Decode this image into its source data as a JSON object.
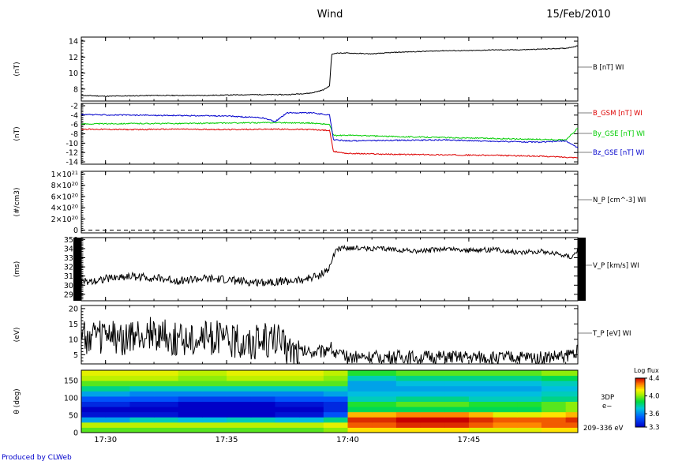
{
  "header": {
    "title": "Wind",
    "date": "15/Feb/2010",
    "footer": "Produced by CLWeb"
  },
  "colors": {
    "black": "#000000",
    "red": "#dd0000",
    "green": "#00cc00",
    "blue": "#0000cc",
    "footer_blue": "#0000cc"
  },
  "time_axis": {
    "start": "17:29:00",
    "end": "17:49:30",
    "tick_labels": [
      "17:30",
      "17:35",
      "17:40",
      "17:45"
    ]
  },
  "chart_data": [
    {
      "type": "line",
      "id": "b_total",
      "ylabel": "(nT)",
      "ylim": [
        6.5,
        14.5
      ],
      "yticks": [
        8,
        10,
        12,
        14
      ],
      "series": [
        {
          "name": "B [nT] WI",
          "color": "#000000",
          "x": [
            "17:29:00",
            "17:30:00",
            "17:32:00",
            "17:34:00",
            "17:36:00",
            "17:37:30",
            "17:38:30",
            "17:39:00",
            "17:39:15",
            "17:39:20",
            "17:39:30",
            "17:40:00",
            "17:41:00",
            "17:42:00",
            "17:43:00",
            "17:44:00",
            "17:45:00",
            "17:46:00",
            "17:47:00",
            "17:48:00",
            "17:49:00",
            "17:49:30"
          ],
          "values": [
            7.2,
            7.1,
            7.2,
            7.2,
            7.3,
            7.3,
            7.5,
            7.9,
            8.4,
            12.3,
            12.5,
            12.5,
            12.4,
            12.6,
            12.7,
            12.8,
            12.8,
            12.9,
            12.9,
            13.0,
            13.1,
            13.4
          ]
        }
      ]
    },
    {
      "type": "line",
      "id": "b_components",
      "ylabel": "(nT)",
      "ylim": [
        -14.5,
        -1.5
      ],
      "yticks": [
        -2,
        -4,
        -6,
        -8,
        -10,
        -12,
        -14
      ],
      "series": [
        {
          "name": "B_GSM [nT] WI",
          "color": "#dd0000",
          "x": [
            "17:29:00",
            "17:31:00",
            "17:33:00",
            "17:35:00",
            "17:37:00",
            "17:38:30",
            "17:39:15",
            "17:39:25",
            "17:40:00",
            "17:42:00",
            "17:44:00",
            "17:46:00",
            "17:48:00",
            "17:49:30"
          ],
          "values": [
            -7.0,
            -7.1,
            -7.0,
            -7.1,
            -7.0,
            -7.1,
            -7.3,
            -11.8,
            -12.2,
            -12.4,
            -12.5,
            -12.6,
            -12.8,
            -13.1
          ]
        },
        {
          "name": "By_GSE [nT] WI",
          "color": "#00cc00",
          "x": [
            "17:29:00",
            "17:31:00",
            "17:33:00",
            "17:35:00",
            "17:37:00",
            "17:38:30",
            "17:39:15",
            "17:39:25",
            "17:40:00",
            "17:42:00",
            "17:44:00",
            "17:46:00",
            "17:48:00",
            "17:49:00",
            "17:49:30"
          ],
          "values": [
            -5.9,
            -5.8,
            -5.8,
            -5.7,
            -5.6,
            -5.7,
            -6.0,
            -8.4,
            -8.3,
            -8.6,
            -8.8,
            -9.0,
            -9.2,
            -9.3,
            -6.8
          ]
        },
        {
          "name": "Bz_GSE [nT] WI",
          "color": "#0000cc",
          "x": [
            "17:29:00",
            "17:31:00",
            "17:33:00",
            "17:35:00",
            "17:36:30",
            "17:37:00",
            "17:37:30",
            "17:38:30",
            "17:39:15",
            "17:39:25",
            "17:40:00",
            "17:42:00",
            "17:44:00",
            "17:46:00",
            "17:48:00",
            "17:49:00",
            "17:49:30"
          ],
          "values": [
            -3.9,
            -4.0,
            -4.1,
            -4.2,
            -4.6,
            -5.4,
            -3.5,
            -3.5,
            -4.0,
            -9.3,
            -9.5,
            -9.4,
            -9.3,
            -9.6,
            -9.8,
            -9.5,
            -11.0
          ]
        }
      ]
    },
    {
      "type": "line",
      "id": "density",
      "ylabel": "(#/cm3)",
      "ylim": [
        -5e+19,
        1.05e+21
      ],
      "yticks": [
        0,
        2e+20,
        4e+20,
        6e+20,
        8e+20,
        1e+21
      ],
      "ytick_labels": [
        {
          "mant": "0",
          "exp": ""
        },
        {
          "mant": "2×10",
          "exp": "20"
        },
        {
          "mant": "4×10",
          "exp": "20"
        },
        {
          "mant": "6×10",
          "exp": "20"
        },
        {
          "mant": "8×10",
          "exp": "20"
        },
        {
          "mant": "1×10",
          "exp": "21"
        }
      ],
      "series": [
        {
          "name": "N_P [cm^-3] WI",
          "color": "#000000",
          "dashed": true,
          "x": [
            "17:29:00",
            "17:49:30"
          ],
          "values": [
            0,
            0
          ]
        }
      ]
    },
    {
      "type": "line",
      "id": "velocity",
      "ylabel": "(ms)",
      "ylim": [
        283,
        352
      ],
      "yticks": [
        290,
        300,
        310,
        320,
        330,
        340,
        350
      ],
      "series": [
        {
          "name": "V_P [km/s] WI",
          "color": "#000000",
          "x": [
            "17:29:00",
            "17:30:00",
            "17:31:00",
            "17:32:00",
            "17:33:00",
            "17:34:00",
            "17:35:00",
            "17:36:00",
            "17:37:00",
            "17:38:00",
            "17:38:45",
            "17:39:15",
            "17:39:30",
            "17:40:00",
            "17:41:00",
            "17:42:00",
            "17:43:00",
            "17:44:00",
            "17:45:00",
            "17:46:00",
            "17:47:00",
            "17:48:00",
            "17:48:45",
            "17:49:15",
            "17:49:30"
          ],
          "values": [
            303,
            307,
            310,
            308,
            305,
            307,
            306,
            303,
            304,
            305,
            310,
            318,
            339,
            341,
            340,
            339,
            337,
            340,
            338,
            339,
            336,
            337,
            334,
            331,
            339
          ]
        }
      ]
    },
    {
      "type": "line",
      "id": "temperature",
      "ylabel": "(eV)",
      "ylim": [
        2,
        21
      ],
      "yticks": [
        5,
        10,
        15,
        20
      ],
      "series": [
        {
          "name": "T_P [eV] WI",
          "color": "#000000",
          "x": [
            "17:29:00",
            "17:30:00",
            "17:31:00",
            "17:32:00",
            "17:33:00",
            "17:34:00",
            "17:35:00",
            "17:36:00",
            "17:37:00",
            "17:37:30",
            "17:38:00",
            "17:39:00",
            "17:39:15",
            "17:39:30",
            "17:40:00",
            "17:42:00",
            "17:44:00",
            "17:46:00",
            "17:48:00",
            "17:49:00",
            "17:49:30"
          ],
          "values": [
            10,
            11,
            10,
            12,
            10,
            11,
            10,
            9,
            10,
            7,
            6,
            6,
            8,
            5,
            4.3,
            4.2,
            4.1,
            4.0,
            4.1,
            4.5,
            6.5
          ]
        }
      ]
    },
    {
      "type": "heatmap",
      "id": "pitch_angle",
      "ylabel": "θ (deg)",
      "ylim": [
        0,
        180
      ],
      "yticks": [
        0,
        50,
        100,
        150
      ],
      "instrument_label": [
        "3DP",
        "e−"
      ],
      "energy_label": "209–336 eV",
      "colorbar": {
        "title": "Log flux",
        "min": 3.3,
        "max": 4.4,
        "ticks": [
          4.4,
          4.0,
          3.6,
          3.3
        ]
      },
      "time_bins": [
        "17:29:00",
        "17:30:00",
        "17:31:00",
        "17:32:00",
        "17:33:00",
        "17:34:00",
        "17:35:00",
        "17:36:00",
        "17:37:00",
        "17:38:00",
        "17:39:00",
        "17:40:00",
        "17:41:00",
        "17:42:00",
        "17:43:00",
        "17:44:00",
        "17:45:00",
        "17:46:00",
        "17:47:00",
        "17:48:00",
        "17:49:00",
        "17:49:30"
      ],
      "angle_bins": [
        0,
        15,
        30,
        45,
        60,
        75,
        90,
        105,
        120,
        135,
        150,
        165,
        180
      ],
      "values": [
        [
          3.95,
          3.95,
          3.95,
          3.95,
          3.95,
          3.95,
          3.95,
          3.95,
          3.95,
          3.95,
          4.0,
          4.15,
          4.15,
          4.15,
          4.15,
          4.15,
          4.1,
          4.1,
          4.1,
          4.15,
          4.15
        ],
        [
          4.05,
          4.05,
          4.05,
          4.05,
          4.05,
          4.05,
          4.05,
          4.05,
          4.05,
          4.05,
          4.1,
          4.3,
          4.3,
          4.35,
          4.35,
          4.35,
          4.3,
          4.25,
          4.25,
          4.3,
          4.3
        ],
        [
          3.65,
          3.65,
          3.75,
          3.75,
          3.7,
          3.7,
          3.75,
          3.75,
          3.7,
          3.7,
          3.8,
          4.35,
          4.35,
          4.4,
          4.4,
          4.4,
          4.35,
          4.3,
          4.3,
          4.3,
          4.35
        ],
        [
          3.35,
          3.35,
          3.35,
          3.35,
          3.3,
          3.3,
          3.3,
          3.3,
          3.35,
          3.35,
          3.5,
          4.2,
          4.2,
          4.25,
          4.25,
          4.25,
          4.2,
          4.1,
          4.1,
          4.15,
          4.2
        ],
        [
          3.3,
          3.3,
          3.3,
          3.3,
          3.3,
          3.3,
          3.3,
          3.3,
          3.3,
          3.3,
          3.4,
          3.85,
          3.85,
          3.85,
          3.85,
          3.85,
          3.85,
          3.85,
          3.85,
          3.95,
          4.0
        ],
        [
          3.4,
          3.4,
          3.35,
          3.35,
          3.3,
          3.3,
          3.3,
          3.3,
          3.35,
          3.35,
          3.4,
          3.9,
          3.9,
          3.95,
          3.95,
          3.95,
          3.9,
          3.9,
          3.9,
          3.95,
          4.0
        ],
        [
          3.5,
          3.5,
          3.5,
          3.5,
          3.45,
          3.45,
          3.45,
          3.45,
          3.5,
          3.5,
          3.5,
          3.75,
          3.75,
          3.8,
          3.8,
          3.8,
          3.75,
          3.75,
          3.75,
          3.8,
          3.8
        ],
        [
          3.65,
          3.65,
          3.6,
          3.6,
          3.6,
          3.6,
          3.6,
          3.6,
          3.6,
          3.6,
          3.65,
          3.7,
          3.7,
          3.7,
          3.7,
          3.7,
          3.7,
          3.7,
          3.7,
          3.75,
          3.75
        ],
        [
          3.8,
          3.8,
          3.75,
          3.75,
          3.75,
          3.75,
          3.75,
          3.75,
          3.75,
          3.75,
          3.75,
          3.65,
          3.65,
          3.65,
          3.65,
          3.65,
          3.65,
          3.65,
          3.65,
          3.7,
          3.7
        ],
        [
          3.95,
          3.95,
          3.95,
          3.95,
          3.95,
          3.95,
          3.95,
          3.95,
          3.95,
          3.95,
          3.95,
          3.65,
          3.65,
          3.7,
          3.7,
          3.7,
          3.7,
          3.7,
          3.7,
          3.75,
          3.75
        ],
        [
          4.05,
          4.05,
          4.05,
          4.05,
          4.0,
          4.0,
          4.05,
          4.05,
          4.05,
          4.05,
          4.0,
          3.75,
          3.75,
          3.8,
          3.8,
          3.8,
          3.8,
          3.8,
          3.8,
          3.85,
          3.85
        ],
        [
          4.1,
          4.1,
          4.1,
          4.1,
          4.05,
          4.05,
          4.1,
          4.1,
          4.1,
          4.1,
          4.05,
          3.9,
          3.9,
          3.95,
          3.95,
          3.95,
          3.95,
          3.95,
          3.95,
          4.0,
          4.0
        ]
      ]
    }
  ]
}
